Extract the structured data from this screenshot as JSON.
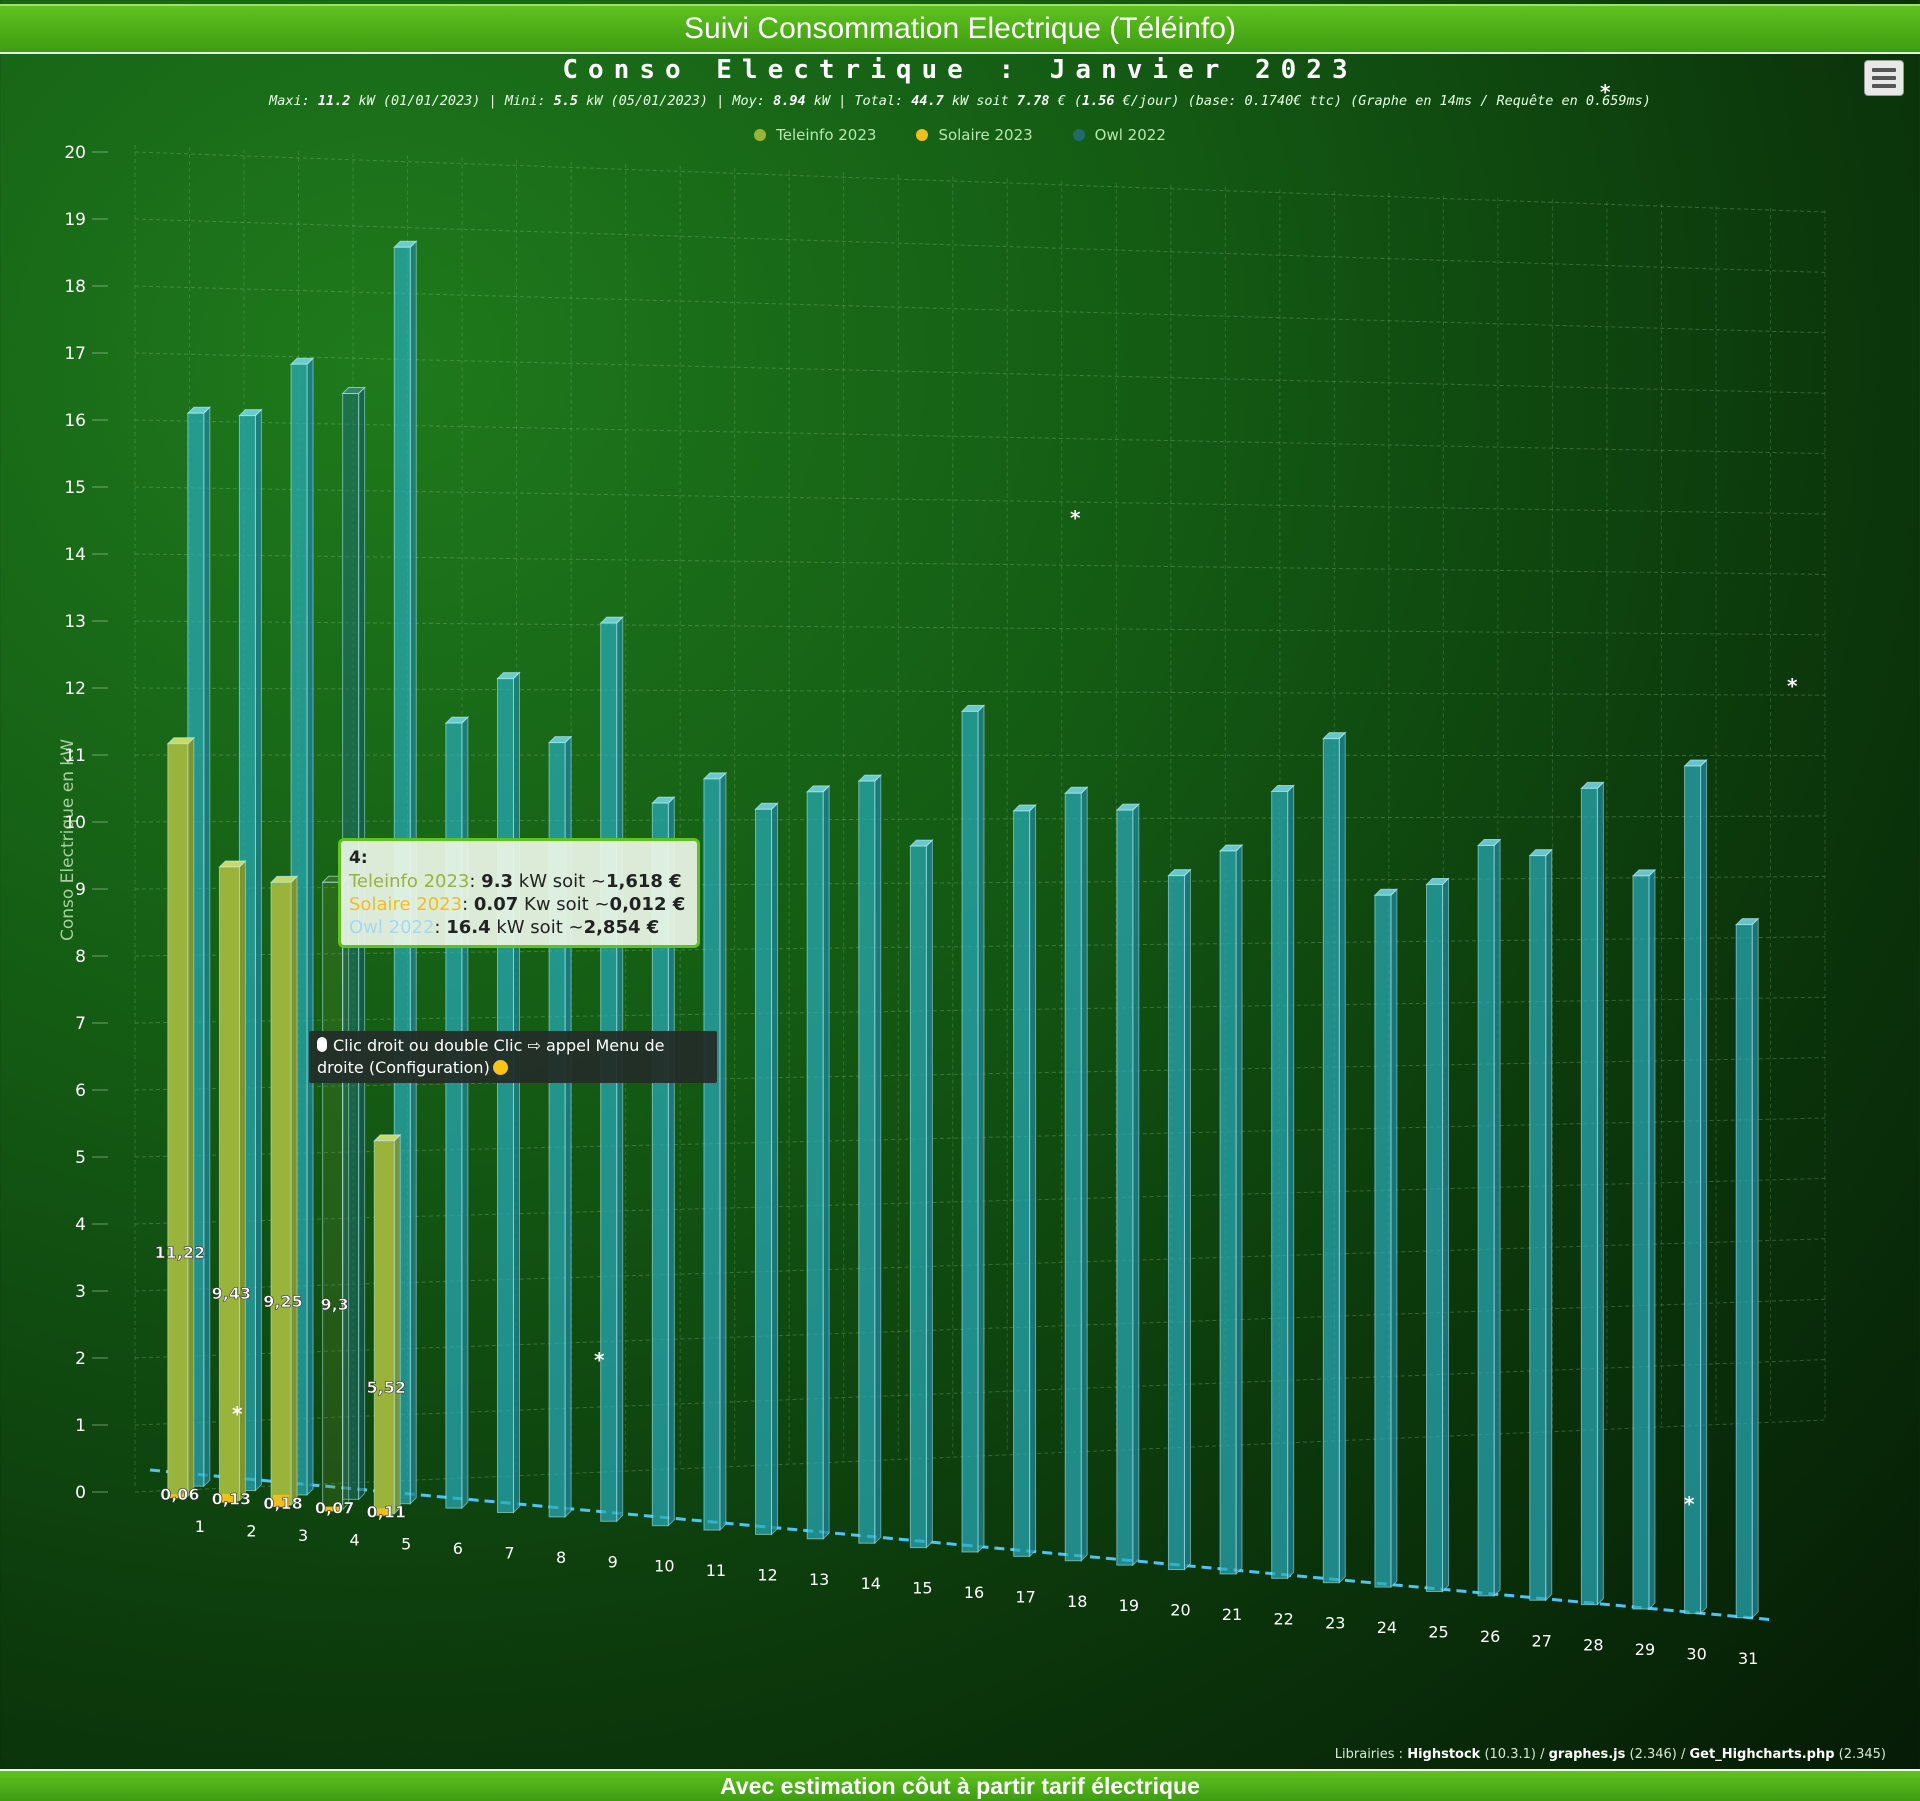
{
  "header": {
    "title": "Suivi Consommation Electrique (Téléinfo)"
  },
  "footer": {
    "title": "Avec estimation côut à partir tarif électrique"
  },
  "chart_title": "Conso Electrique : Janvier 2023",
  "subtitle": {
    "maxi_label": "Maxi: ",
    "maxi_value": "11.2",
    "maxi_unit": " kW (01/01/2023) | Mini: ",
    "mini_value": "5.5",
    "mini_unit": " kW (05/01/2023) | Moy: ",
    "moy_value": "8.94",
    "moy_unit": " kW | Total: ",
    "total_value": "44.7",
    "total_unit": " kW soit ",
    "cost_value": "7.78",
    "cost_unit": " € (",
    "perday_value": "1.56",
    "perday_unit": " €/jour) (base: 0.1740€ ttc) (Graphe en 14ms / Requête en 0.659ms)"
  },
  "menu": {
    "icon": "hamburger-menu-icon"
  },
  "legend": [
    {
      "name": "Teleinfo 2023",
      "color": "#9ab33b"
    },
    {
      "name": "Solaire 2023",
      "color": "#f0bf1a"
    },
    {
      "name": "Owl 2022",
      "color": "#1f6b6e"
    }
  ],
  "tooltip": {
    "day": "4:",
    "lines": [
      {
        "series": "Teleinfo 2023",
        "sep": ": ",
        "value": "9.3",
        "unit": " kW soit ~",
        "cost": "1,618 €"
      },
      {
        "series": "Solaire 2023",
        "sep": ": ",
        "value": "0.07",
        "unit": " Kw soit ~",
        "cost": "0,012 €"
      },
      {
        "series": "Owl 2022",
        "sep": ": ",
        "value": "16.4",
        "unit": " kW soit ~",
        "cost": "2,854 €"
      }
    ]
  },
  "hint": {
    "text": "Clic droit ou double Clic ⇨ appel Menu de droite (Configuration)"
  },
  "credits": {
    "prefix": "Librairies : ",
    "lib1": "Highstock",
    "ver1": " (10.3.1) / ",
    "lib2": "graphes.js",
    "ver2": " (2.346) / ",
    "lib3": "Get_Highcharts.php",
    "ver3": " (2.345)"
  },
  "chart_data": {
    "type": "bar",
    "ylabel": "Conso Electrique en kW",
    "ylim": [
      0,
      20
    ],
    "yticks": [
      0,
      1,
      2,
      3,
      4,
      5,
      6,
      7,
      8,
      9,
      10,
      11,
      12,
      13,
      14,
      15,
      16,
      17,
      18,
      19,
      20
    ],
    "categories": [
      "1",
      "2",
      "3",
      "4",
      "5",
      "6",
      "7",
      "8",
      "9",
      "10",
      "11",
      "12",
      "13",
      "14",
      "15",
      "16",
      "17",
      "18",
      "19",
      "20",
      "21",
      "22",
      "23",
      "24",
      "25",
      "26",
      "27",
      "28",
      "29",
      "30",
      "31"
    ],
    "grid": true,
    "legend_position": "top-center",
    "series": [
      {
        "name": "Teleinfo 2023",
        "color": "#9ab33b",
        "values": [
          11.22,
          9.43,
          9.25,
          9.3,
          5.52
        ],
        "labels": [
          "11,22",
          "9,43",
          "9,25",
          "9,3",
          "5,52"
        ]
      },
      {
        "name": "Solaire 2023",
        "color": "#f0bf1a",
        "values": [
          0.06,
          0.13,
          0.18,
          0.07,
          0.11
        ],
        "labels": [
          "0,06",
          "0,13",
          "0,18",
          "0,07",
          "0,11"
        ]
      },
      {
        "name": "Owl 2022",
        "color": "#2cb8c8",
        "values": [
          16.0,
          16.0,
          16.8,
          16.4,
          18.6,
          11.6,
          12.3,
          11.4,
          13.2,
          10.6,
          11.0,
          10.6,
          10.9,
          11.1,
          10.2,
          12.2,
          10.8,
          11.1,
          10.9,
          10.0,
          10.4,
          11.3,
          12.1,
          9.9,
          10.1,
          10.7,
          10.6,
          11.6,
          10.4,
          12.0,
          9.8
        ]
      }
    ]
  }
}
